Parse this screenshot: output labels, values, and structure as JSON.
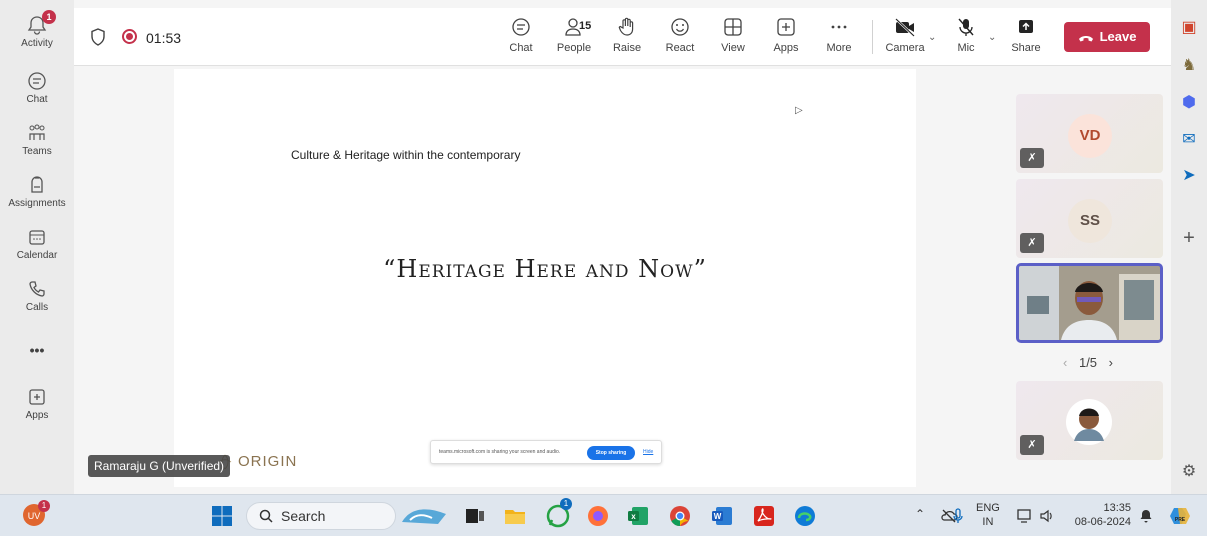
{
  "rail": {
    "activity": "Activity",
    "activity_badge": "1",
    "chat": "Chat",
    "teams": "Teams",
    "assignments": "Assignments",
    "calendar": "Calendar",
    "calls": "Calls",
    "more": "•••",
    "apps": "Apps"
  },
  "toolbar": {
    "timer": "01:53",
    "chat": "Chat",
    "people": "People",
    "people_count": "15",
    "raise": "Raise",
    "react": "React",
    "view": "View",
    "apps": "Apps",
    "more": "More",
    "camera": "Camera",
    "mic": "Mic",
    "share": "Share",
    "leave": "Leave"
  },
  "slide": {
    "subtitle": "Culture & Heritage within the contemporary",
    "title": "“Heritage Here and Now”",
    "share_message": "teams.microsoft.com is sharing your screen and audio.",
    "stop_sharing": "Stop sharing",
    "hide": "Hide",
    "brand": "ORIGIN"
  },
  "presenter_name": "Ramaraju G (Unverified)",
  "participants": [
    {
      "initials": "VD",
      "color": "#fbe3da",
      "text_color": "#b24a2f"
    },
    {
      "initials": "SS",
      "color": "#efe6dc",
      "text_color": "#5f5048"
    }
  ],
  "pager": {
    "prev": "‹",
    "label": "1/5",
    "next": "›"
  },
  "taskbar": {
    "user_badge": "1",
    "search": "Search",
    "whatsapp_badge": "1",
    "lang_line1": "ENG",
    "lang_line2": "IN",
    "time": "13:35",
    "date": "08-06-2024"
  },
  "colors": {
    "leave": "#c4314b",
    "accent": "#5b5fc7"
  }
}
